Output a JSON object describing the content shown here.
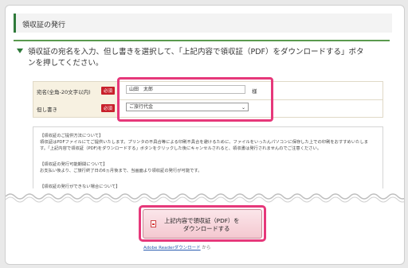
{
  "header": {
    "title": "領収証の発行"
  },
  "instruction": {
    "line1": "領収証の宛名を入力、但し書きを選択して、「上記内容で領収証（PDF）をダウンロードする」ボタ",
    "line2": "ンを押してください。"
  },
  "form": {
    "name_label": "宛名(全角-20文字以内)",
    "required_badge": "必須",
    "name_value": "山田　太郎",
    "name_suffix": "様",
    "memo_label": "但し書き",
    "memo_value": "ご旅行代金"
  },
  "notice": {
    "h1": "【領収証のご提供方法について】",
    "p1a": "領収証はPDFファイルにてご提供いたします。プリンタの不具合等による印刷不具合を避けるために、ファイルをいったんパソコンに保存した上での印刷をおすすめいたしま",
    "p1b": "す。「上記内容で領収証（PDF)をダウンロードする」ボタンをクリックした後にキャンセルされると、領収書は発行されませんのでご注意ください。",
    "h2": "【領収証の発行可能期間について】",
    "p2": "お支払い後より、ご旅行終了日の6ヵ月後まで、当画面より領収証の発行が可能です。",
    "h3": "【領収証の発行ができない場合について】"
  },
  "download": {
    "line1": "上記内容で領収証（PDF）を",
    "line2": "ダウンロードする"
  },
  "reader": {
    "link": "Adobe Readerダウンロード",
    "suffix": "から"
  },
  "colors": {
    "accent": "#e6387a",
    "brand_green": "#2f7a3a",
    "required": "#c8202b"
  }
}
